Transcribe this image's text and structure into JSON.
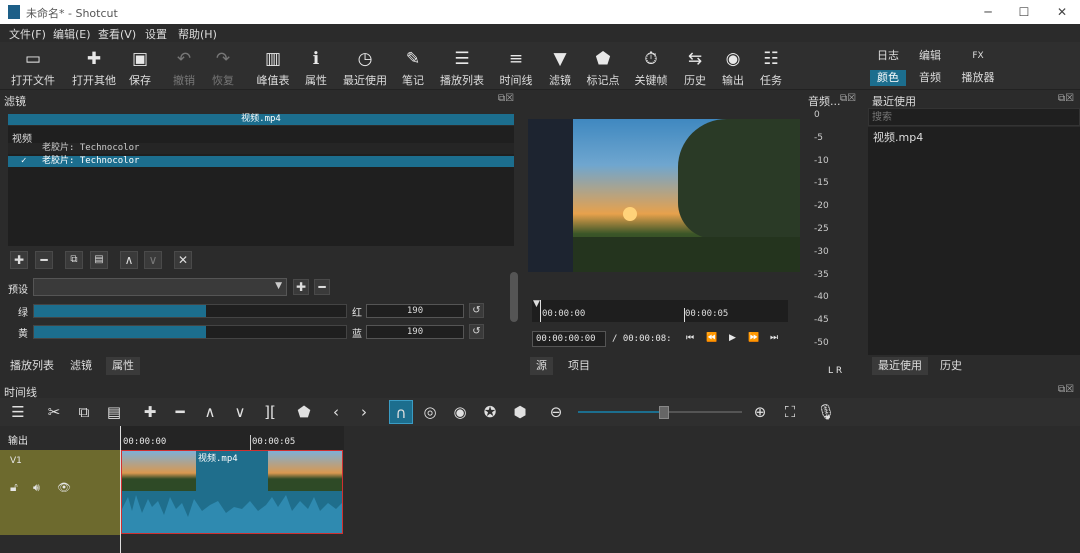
{
  "window": {
    "title": "未命名* - Shotcut",
    "minimize": "─",
    "maximize": "☐",
    "close": "✕"
  },
  "menu": [
    "文件(F)",
    "编辑(E)",
    "查看(V)",
    "设置",
    "帮助(H)"
  ],
  "toolbar": {
    "open_file": {
      "label": "打开文件",
      "icon": "folder-icon"
    },
    "open_other": {
      "label": "打开其他",
      "icon": "plus-document-icon"
    },
    "save": {
      "label": "保存",
      "icon": "save-icon"
    },
    "undo": {
      "label": "撤销",
      "icon": "undo-icon"
    },
    "redo": {
      "label": "恢复",
      "icon": "redo-icon"
    },
    "peak": {
      "label": "峰值表",
      "icon": "peak-meter-icon"
    },
    "properties": {
      "label": "属性",
      "icon": "info-icon"
    },
    "recent": {
      "label": "最近使用",
      "icon": "clock-icon"
    },
    "notes": {
      "label": "笔记",
      "icon": "notes-icon"
    },
    "playlist": {
      "label": "播放列表",
      "icon": "list-icon"
    },
    "timeline": {
      "label": "时间线",
      "icon": "timeline-icon"
    },
    "filters": {
      "label": "滤镜",
      "icon": "filter-icon"
    },
    "markers": {
      "label": "标记点",
      "icon": "marker-icon"
    },
    "keyframes": {
      "label": "关键帧",
      "icon": "stopwatch-icon"
    },
    "history": {
      "label": "历史",
      "icon": "history-icon"
    },
    "export": {
      "label": "输出",
      "icon": "disc-icon"
    },
    "jobs": {
      "label": "任务",
      "icon": "database-icon"
    }
  },
  "right_tabs": {
    "row1": [
      "日志",
      "编辑",
      "FX"
    ],
    "row2": [
      "颜色",
      "音频",
      "播放器"
    ],
    "active": "颜色"
  },
  "filter_panel": {
    "title": "滤镜",
    "clip_name": "视频.mp4",
    "category": "视频",
    "filters": [
      {
        "name": "老胶片: Technocolor",
        "checked": false,
        "selected": false
      },
      {
        "name": "老胶片: Technocolor",
        "checked": true,
        "selected": true
      }
    ],
    "preset_label": "预设",
    "green_label": "绿",
    "red_label": "红",
    "red_value": "190",
    "yellow_label": "黄",
    "blue_label": "蓝",
    "blue_value": "190",
    "green_fill_pct": 55,
    "yellow_fill_pct": 55,
    "tabs": [
      "播放列表",
      "滤镜",
      "属性"
    ],
    "active_tab": "属性"
  },
  "player": {
    "ruler": [
      "00:00:00",
      "00:00:05"
    ],
    "position": "00:00:00:00",
    "duration": "/ 00:00:08:",
    "tabs": [
      "源",
      "项目"
    ]
  },
  "audio": {
    "title": "音频...",
    "ticks": [
      "0",
      "-5",
      "-10",
      "-15",
      "-20",
      "-25",
      "-30",
      "-35",
      "-40",
      "-45",
      "-50"
    ],
    "lr": "L R"
  },
  "recent_panel": {
    "title": "最近使用",
    "search_placeholder": "搜索",
    "items": [
      "视频.mp4"
    ],
    "tabs": [
      "最近使用",
      "历史"
    ]
  },
  "timeline": {
    "title": "时间线",
    "output_label": "输出",
    "track": "V1",
    "ruler": [
      "00:00:00",
      "00:00:05"
    ],
    "clip_name": "视频.mp4",
    "zoom_pct": 52
  }
}
